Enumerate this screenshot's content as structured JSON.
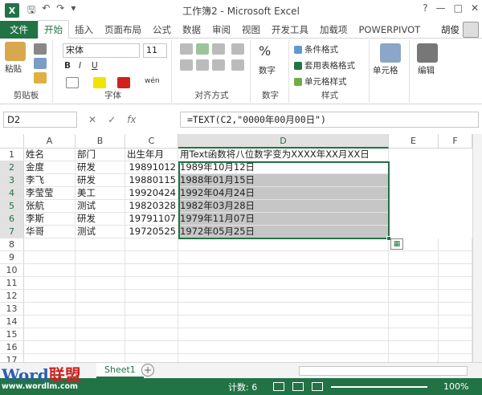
{
  "titlebar": {
    "app_icon": "X",
    "qat_icons": [
      "save-icon",
      "undo-icon",
      "redo-icon",
      "customize-icon"
    ],
    "title": "工作簿2 - Microsoft Excel",
    "controls": [
      "?",
      "—",
      "□",
      "✕"
    ]
  },
  "tabs": [
    "文件",
    "开始",
    "插入",
    "页面布局",
    "公式",
    "数据",
    "审阅",
    "视图",
    "开发工具",
    "加载项",
    "POWERPIVOT"
  ],
  "active_tab": "开始",
  "user": {
    "name": "胡俊"
  },
  "ribbon": {
    "clipboard": {
      "label": "剪贴板",
      "paste": "粘贴"
    },
    "font": {
      "label": "字体",
      "name": "宋体",
      "size": "11",
      "bold": "B",
      "italic": "I",
      "underline": "U",
      "phonetic": "wén"
    },
    "alignment": {
      "label": "对齐方式"
    },
    "number": {
      "label": "数字",
      "button": "数字",
      "percent": "%"
    },
    "styles": {
      "label": "样式",
      "conditional": "条件格式",
      "table": "套用表格格式",
      "cell_styles": "单元格样式"
    },
    "cells": {
      "button": "单元格"
    },
    "editing": {
      "button": "编辑"
    }
  },
  "formula_bar": {
    "name_box": "D2",
    "cancel": "✕",
    "enter": "✓",
    "fx": "fx",
    "formula": "=TEXT(C2,\"0000年00月00日\")"
  },
  "columns": [
    "A",
    "B",
    "C",
    "D",
    "E",
    "F"
  ],
  "selected_column": "D",
  "rows": [
    "1",
    "2",
    "3",
    "4",
    "5",
    "6",
    "7",
    "8",
    "9",
    "10",
    "11",
    "12",
    "13",
    "14",
    "15",
    "16",
    "17"
  ],
  "selected_rows": [
    "2",
    "3",
    "4",
    "5",
    "6",
    "7"
  ],
  "table": {
    "headers": [
      "姓名",
      "部门",
      "出生年月",
      "用Text函数将八位数字变为XXXX年XX月XX日"
    ],
    "data": [
      [
        "金度",
        "研发",
        "19891012",
        "1989年10月12日"
      ],
      [
        "李飞",
        "研发",
        "19880115",
        "1988年01月15日"
      ],
      [
        "李莹莹",
        "美工",
        "19920424",
        "1992年04月24日"
      ],
      [
        "张航",
        "测试",
        "19820328",
        "1982年03月28日"
      ],
      [
        "李斯",
        "研发",
        "19791107",
        "1979年11月07日"
      ],
      [
        "华哥",
        "测试",
        "19720525",
        "1972年05月25日"
      ]
    ]
  },
  "quick_analysis_icon": "quick-analysis-icon",
  "sheet": {
    "tab": "Sheet1",
    "add": "+"
  },
  "status": {
    "count": "计数: 6",
    "zoom": "100%"
  },
  "watermark": {
    "brand_word": "Word",
    "brand_cn": "联盟",
    "url": "www.wordlm.com"
  },
  "colors": {
    "accent": "#217346",
    "selection": "#c6c6c6"
  }
}
